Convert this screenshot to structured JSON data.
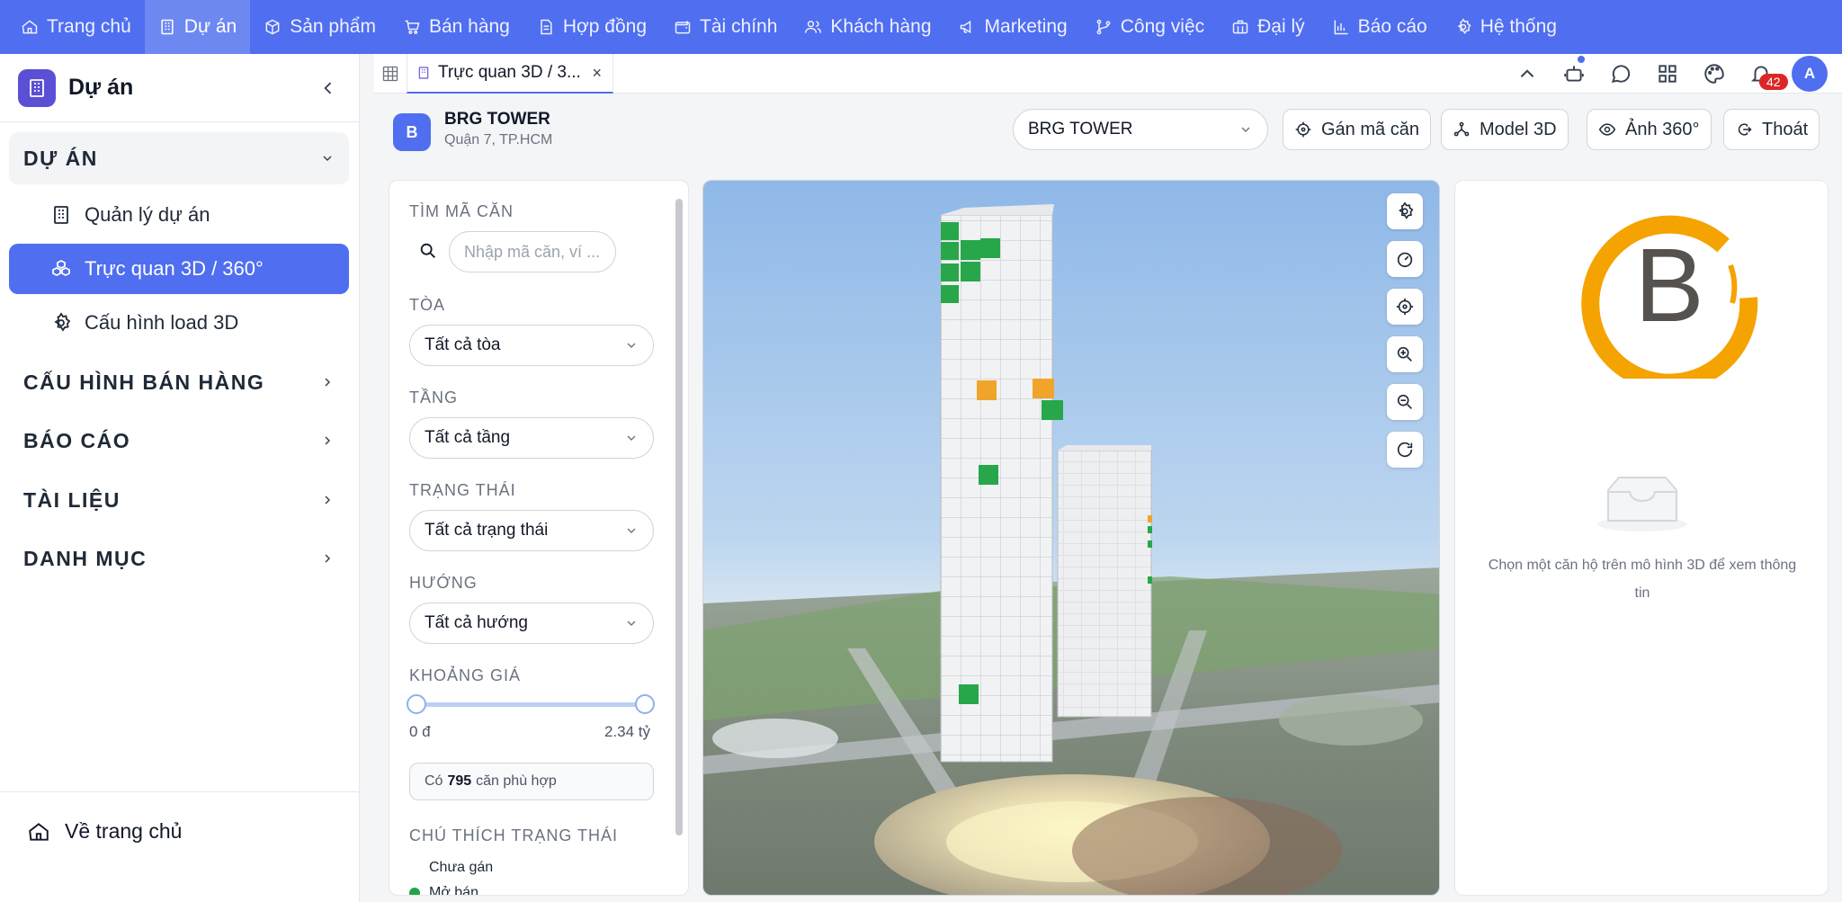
{
  "topnav": {
    "items": [
      {
        "label": "Trang chủ",
        "icon": "home-icon"
      },
      {
        "label": "Dự án",
        "icon": "building-icon",
        "active": true
      },
      {
        "label": "Sản phẩm",
        "icon": "cube-icon"
      },
      {
        "label": "Bán hàng",
        "icon": "cart-icon"
      },
      {
        "label": "Hợp đồng",
        "icon": "file-icon"
      },
      {
        "label": "Tài chính",
        "icon": "wallet-icon"
      },
      {
        "label": "Khách hàng",
        "icon": "users-icon"
      },
      {
        "label": "Marketing",
        "icon": "megaphone-icon"
      },
      {
        "label": "Công việc",
        "icon": "branch-icon"
      },
      {
        "label": "Đại lý",
        "icon": "briefcase-icon"
      },
      {
        "label": "Báo cáo",
        "icon": "bar-chart-icon"
      },
      {
        "label": "Hệ thống",
        "icon": "gear-icon"
      }
    ]
  },
  "sidebar": {
    "title": "Dự án",
    "groups": {
      "du_an": "DỰ ÁN",
      "cau_hinh": "CẤU HÌNH BÁN HÀNG",
      "bao_cao": "BÁO CÁO",
      "tai_lieu": "TÀI LIỆU",
      "danh_muc": "DANH MỤC"
    },
    "sub": {
      "quan_ly": "Quản lý dự án",
      "truc_quan": "Trực quan 3D / 360°",
      "cau_hinh_load": "Cấu hình load 3D"
    },
    "home": "Về trang chủ"
  },
  "tabbar": {
    "tab_label": "Trực quan 3D / 3...",
    "close": "×",
    "notif_count": "42",
    "avatar": "A"
  },
  "project": {
    "badge": "B",
    "name": "BRG TOWER",
    "location": "Quận 7, TP.HCM",
    "selected": "BRG TOWER",
    "buttons": {
      "assign": "Gán mã căn",
      "model": "Model 3D",
      "photo": "Ảnh 360°",
      "exit": "Thoát"
    }
  },
  "filters": {
    "search_label": "TÌM MÃ CĂN",
    "search_placeholder": "Nhập mã căn, ví ...",
    "toa_label": "TÒA",
    "toa_value": "Tất cả tòa",
    "tang_label": "TẦNG",
    "tang_value": "Tất cả tầng",
    "trang_thai_label": "TRẠNG THÁI",
    "trang_thai_value": "Tất cả trạng thái",
    "huong_label": "HƯỚNG",
    "huong_value": "Tất cả hướng",
    "price_label": "KHOẢNG GIÁ",
    "price_min": "0 đ",
    "price_max": "2.34 tỷ",
    "count_prefix": "Có",
    "count_value": "795",
    "count_suffix": "căn phù hợp",
    "legend_label": "CHÚ THÍCH TRẠNG THÁI",
    "legend": [
      {
        "label": "Chưa gán",
        "color": "#ffffff"
      },
      {
        "label": "Mở bán",
        "color": "#22a447"
      }
    ]
  },
  "info": {
    "brand_letter": "B",
    "empty_text": "Chọn một căn hộ trên mô hình 3D để xem thông tin"
  },
  "colors": {
    "primary": "#4f6ef0",
    "open_sale": "#22a447",
    "reserved": "#f0a52a",
    "brand_orange": "#f5a300"
  }
}
